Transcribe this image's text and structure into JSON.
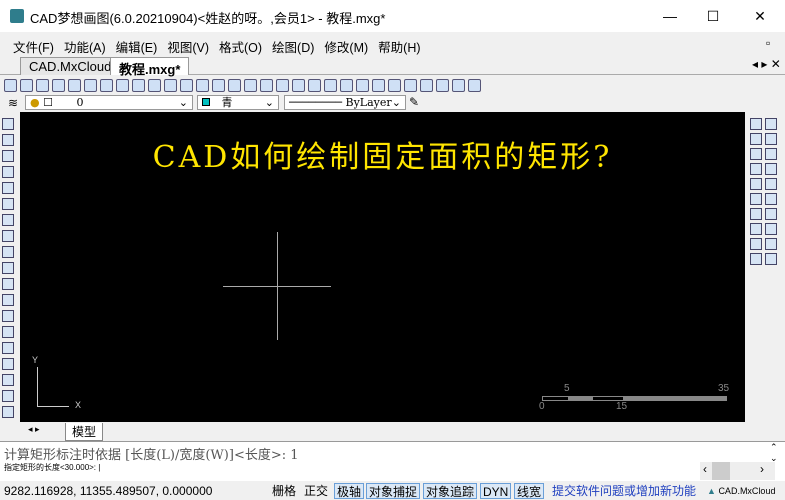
{
  "window": {
    "title": "CAD梦想画图(6.0.20210904)<姓赵的呀。,会员1> - 教程.mxg*",
    "min": "—",
    "max": "☐",
    "close": "✕"
  },
  "menu": [
    "文件(F)",
    "功能(A)",
    "编辑(E)",
    "视图(V)",
    "格式(O)",
    "绘图(D)",
    "修改(M)",
    "帮助(H)"
  ],
  "tabs": [
    {
      "label": "CAD.MxCloud",
      "active": false
    },
    {
      "label": "教程.mxg*",
      "active": true
    }
  ],
  "layer_bar": {
    "layer": "0",
    "color": "青",
    "color_hex": "#00c0c0",
    "linetype": "ByLayer"
  },
  "canvas": {
    "heading": "CAD如何绘制固定面积的矩形?",
    "heading_color": "#ffe500",
    "ucs_y": "Y",
    "ucs_x": "X",
    "scale_labels": [
      "0",
      "5",
      "15",
      "35"
    ]
  },
  "layout_tabs": {
    "model": "模型"
  },
  "command": {
    "history": "计算矩形标注时依据 [长度(L)/宽度(W)]<长度>: 1",
    "prompt": "指定矩形的长度<30.000>:"
  },
  "status": {
    "coords": "9282.116928, 11355.489507, 0.000000",
    "toggles": [
      {
        "label": "栅格",
        "on": false
      },
      {
        "label": "正交",
        "on": false
      },
      {
        "label": "极轴",
        "on": true
      },
      {
        "label": "对象捕捉",
        "on": true
      },
      {
        "label": "对象追踪",
        "on": true
      },
      {
        "label": "DYN",
        "on": true
      },
      {
        "label": "线宽",
        "on": true
      }
    ],
    "feedback": "提交软件问题或增加新功能",
    "brand": "CAD.MxCloud"
  }
}
